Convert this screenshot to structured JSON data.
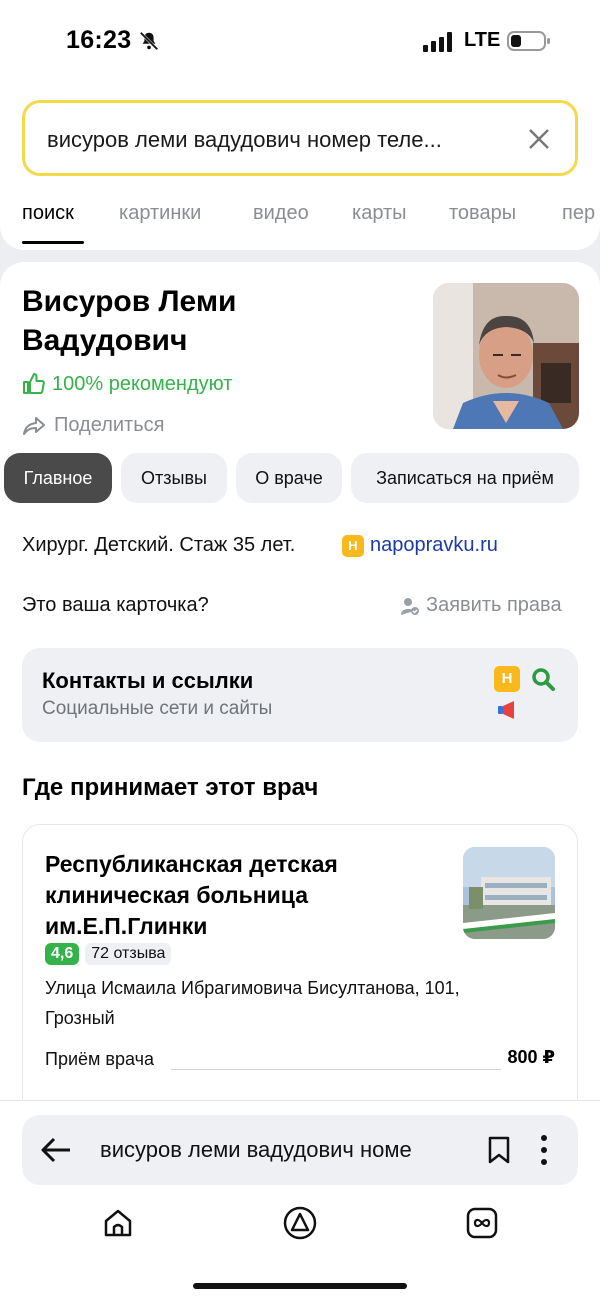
{
  "status_bar": {
    "time": "16:23",
    "network": "LTE"
  },
  "search": {
    "query": "висуров леми вадудович номер теле..."
  },
  "tabs": [
    {
      "label": "поиск",
      "active": true
    },
    {
      "label": "картинки"
    },
    {
      "label": "видео"
    },
    {
      "label": "карты"
    },
    {
      "label": "товары"
    },
    {
      "label": "пер"
    }
  ],
  "doctor": {
    "name": "Висуров Леми Вадудович",
    "recommend": "100% рекомендуют",
    "share": "Поделиться",
    "chips": [
      "Главное",
      "Отзывы",
      "О враче",
      "Записаться на приём"
    ],
    "specialty": "Хирург. Детский. Стаж 35 лет.",
    "source_badge": "Н",
    "source": "napopravku.ru",
    "your_card": "Это ваша карточка?",
    "claim": "Заявить права"
  },
  "contacts": {
    "title": "Контакты и ссылки",
    "subtitle": "Социальные сети и сайты",
    "badge": "Н"
  },
  "where": {
    "title": "Где принимает этот врач"
  },
  "clinic": {
    "name": "Республиканская детская клиническая больница им.Е.П.Глинки",
    "rating": "4,6",
    "reviews": "72 отзыва",
    "address": "Улица Исмаила Ибрагимовича Бисултанова, 101, Грозный",
    "price_label": "Приём врача",
    "price": "800 ₽"
  },
  "bottom": {
    "url": "висуров леми вадудович номе"
  },
  "colors": {
    "accent_yellow": "#f4d94a",
    "green": "#34b34a",
    "link": "#1c3aa8"
  }
}
